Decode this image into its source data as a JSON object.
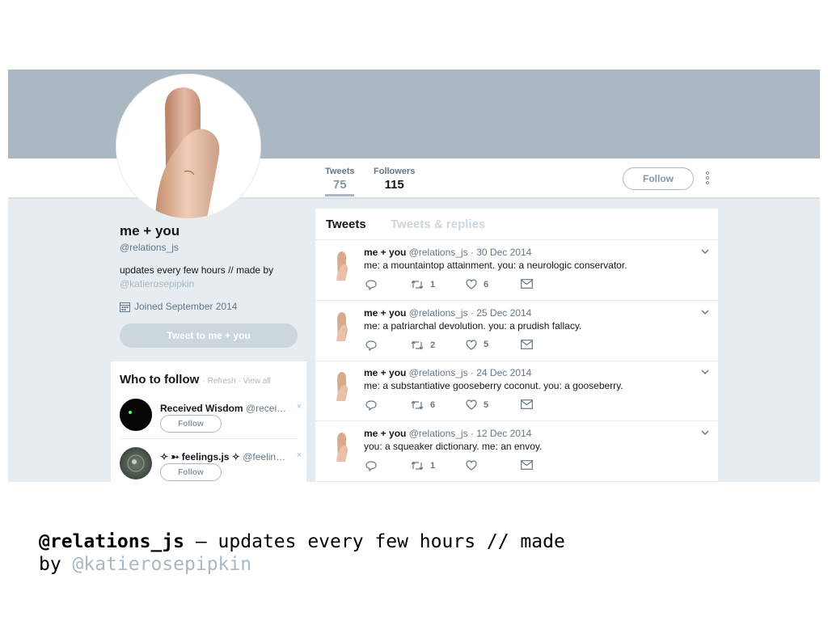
{
  "profile": {
    "name": "me + you",
    "handle": "@relations_js",
    "bio": "updates every few hours // made by",
    "bio_link": "@katierosepipkin",
    "joined": "Joined September 2014",
    "tweet_to_label": "Tweet to me + you"
  },
  "nav": {
    "stats": [
      {
        "label": "Tweets",
        "value": "75"
      },
      {
        "label": "Followers",
        "value": "115"
      }
    ],
    "follow_label": "Follow"
  },
  "who_to_follow": {
    "title": "Who to follow",
    "refresh": "Refresh",
    "view_all": "View all",
    "suggestions": [
      {
        "name": "Received Wisdom",
        "handle": "@recei…",
        "follow": "Follow",
        "dismiss": "×"
      },
      {
        "name": "✧ ➳ feelings.js ✧",
        "handle": "@feelin…",
        "follow": "Follow",
        "dismiss": "×"
      }
    ]
  },
  "timeline": {
    "tabs": [
      "Tweets",
      "Tweets & replies"
    ],
    "tweets": [
      {
        "name": "me + you",
        "meta": "@relations_js · 30 Dec 2014",
        "text": "me: a mountaintop attainment. you: a neurologic conservator.",
        "retweets": "1",
        "likes": "6"
      },
      {
        "name": "me + you",
        "meta": "@relations_js · 25 Dec 2014",
        "text": "me: a patriarchal devolution. you: a prudish fallacy.",
        "retweets": "2",
        "likes": "5"
      },
      {
        "name": "me + you",
        "meta": "@relations_js · 24 Dec 2014",
        "text": "me: a substantiative gooseberry coconut. you: a gooseberry.",
        "retweets": "6",
        "likes": "5"
      },
      {
        "name": "me + you",
        "meta": "@relations_js · 12 Dec 2014",
        "text": "you: a squeaker dictionary. me: an envoy.",
        "retweets": "1",
        "likes": ""
      }
    ]
  },
  "caption": {
    "handle": "@relations_js",
    "text": " — updates every few hours // made",
    "text2": "by ",
    "link": "@katierosepipkin"
  },
  "icons": [
    "fingers-avatar",
    "calendar-icon",
    "reply-icon",
    "retweet-icon",
    "like-icon",
    "dm-icon",
    "chevron-down-icon",
    "more-icon"
  ]
}
